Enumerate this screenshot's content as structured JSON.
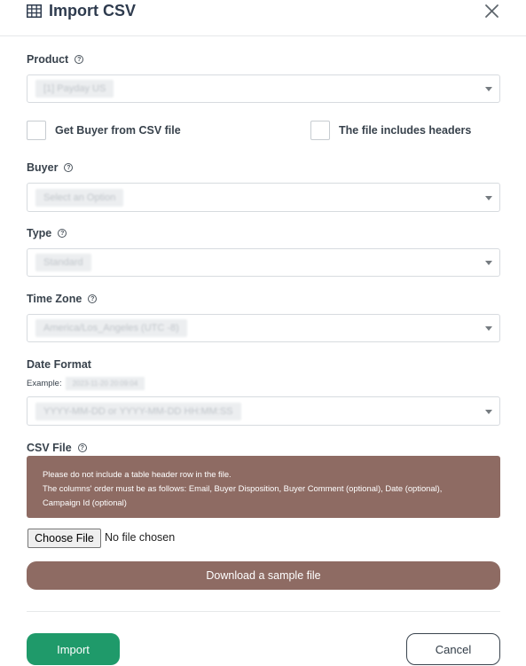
{
  "header": {
    "title": "Import CSV",
    "title_icon": "table-grid-icon",
    "close_icon": "close-icon"
  },
  "form": {
    "product": {
      "label": "Product",
      "value": "[1] Payday US",
      "help_icon": "question-circle-icon"
    },
    "get_buyer_checkbox": {
      "label": "Get Buyer from CSV file",
      "checked": false
    },
    "headers_checkbox": {
      "label": "The file includes headers",
      "checked": false
    },
    "buyer": {
      "label": "Buyer",
      "value": "Select an Option",
      "help_icon": "question-circle-icon"
    },
    "type": {
      "label": "Type",
      "value": "Standard",
      "help_icon": "question-circle-icon"
    },
    "time_zone": {
      "label": "Time Zone",
      "value": "America/Los_Angeles (UTC -8)",
      "help_icon": "question-circle-icon"
    },
    "date_format": {
      "label": "Date Format",
      "example_label": "Example:",
      "example_value": "2023-11-20 20:09:04",
      "value": "YYYY-MM-DD or YYYY-MM-DD HH:MM:SS"
    },
    "csv_file": {
      "label": "CSV File",
      "help_icon": "question-circle-icon",
      "info_line1": "Please do not include a table header row in the file.",
      "info_line2": "The columns' order must be as follows: Email, Buyer Disposition, Buyer Comment (optional), Date (optional),",
      "info_line3": "Campaign Id (optional)",
      "choose_button": "Choose File",
      "file_status": "No file chosen"
    },
    "download_label": "Download a sample file"
  },
  "footer": {
    "import_label": "Import",
    "cancel_label": "Cancel"
  },
  "colors": {
    "accent_brown": "#8e6b63",
    "import_green": "#1f9a6a"
  }
}
